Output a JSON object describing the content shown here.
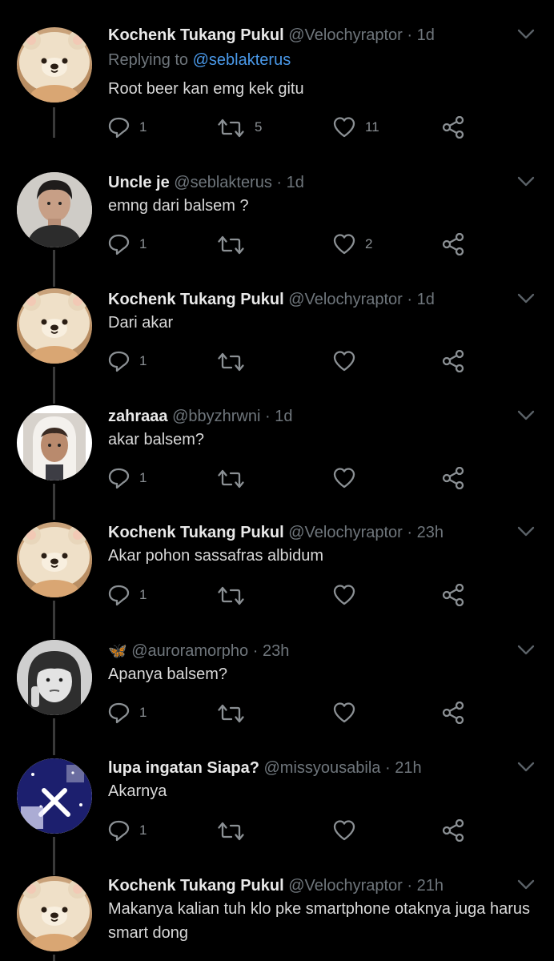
{
  "tweets": [
    {
      "name": "Kochenk Tukang Pukul",
      "handle": "@Velochyraptor",
      "time": "1d",
      "replying_label": "Replying to",
      "replying_to": "@seblakterus",
      "text": "Root beer kan emg kek gitu",
      "replies": "1",
      "retweets": "5",
      "likes": "11",
      "avatar": "bear-hat-avatar"
    },
    {
      "name": "Uncle je",
      "handle": "@seblakterus",
      "time": "1d",
      "text": "emng dari balsem ?",
      "replies": "1",
      "retweets": "",
      "likes": "2",
      "avatar": "boy-avatar"
    },
    {
      "name": "Kochenk Tukang Pukul",
      "handle": "@Velochyraptor",
      "time": "1d",
      "text": "Dari akar",
      "replies": "1",
      "retweets": "",
      "likes": "",
      "avatar": "bear-hat-avatar"
    },
    {
      "name": "zahraaa",
      "handle": "@bbyzhrwni",
      "time": "1d",
      "text": "akar balsem?",
      "replies": "1",
      "retweets": "",
      "likes": "",
      "avatar": "girl-avatar"
    },
    {
      "name": "Kochenk Tukang Pukul",
      "handle": "@Velochyraptor",
      "time": "23h",
      "text": "Akar pohon sassafras albidum",
      "replies": "1",
      "retweets": "",
      "likes": "",
      "avatar": "bear-hat-avatar"
    },
    {
      "name": "🦋",
      "handle": "@auroramorpho",
      "time": "23h",
      "text": "Apanya balsem?",
      "replies": "1",
      "retweets": "",
      "likes": "",
      "avatar": "bw-girl-avatar"
    },
    {
      "name": "lupa ingatan Siapa?",
      "handle": "@missyousabila",
      "time": "21h",
      "text": "Akarnya",
      "replies": "1",
      "retweets": "",
      "likes": "",
      "avatar": "blue-art-avatar"
    },
    {
      "name": "Kochenk Tukang Pukul",
      "handle": "@Velochyraptor",
      "time": "21h",
      "text": "Makanya kalian tuh klo pke smartphone otaknya juga harus smart dong",
      "avatar": "bear-hat-avatar"
    }
  ],
  "separator": "·",
  "colors": {
    "background": "#000000",
    "text": "#d8d8d8",
    "muted": "#6f767c",
    "link": "#4a99e9"
  }
}
